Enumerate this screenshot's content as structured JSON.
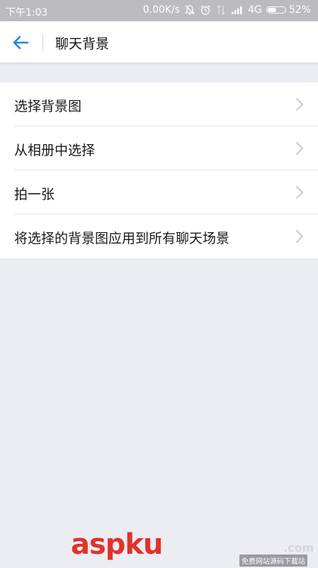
{
  "status_bar": {
    "time": "下午1:03",
    "network_speed": "0.00K/s",
    "network_type": "4G",
    "battery": "52%",
    "battery_level_percent": 52,
    "icons": [
      "bell-off-icon",
      "alarm-icon",
      "data-arrows-icon",
      "signal-icon",
      "battery-icon"
    ]
  },
  "header": {
    "back_icon": "arrow-left-icon",
    "title": "聊天背景"
  },
  "menu": {
    "items": [
      {
        "label": "选择背景图"
      },
      {
        "label": "从相册中选择"
      },
      {
        "label": "拍一张"
      },
      {
        "label": "将选择的背景图应用到所有聊天场景"
      }
    ],
    "item_icon": "chevron-right-icon"
  },
  "watermark": {
    "brand": "aspku",
    "tld": ".com",
    "subtitle": "免费网站源码下载站"
  },
  "colors": {
    "accent": "#1e88e5",
    "background": "#ececf3",
    "status_bar": "#bcbcc0",
    "brand_red": "#e0332a"
  }
}
